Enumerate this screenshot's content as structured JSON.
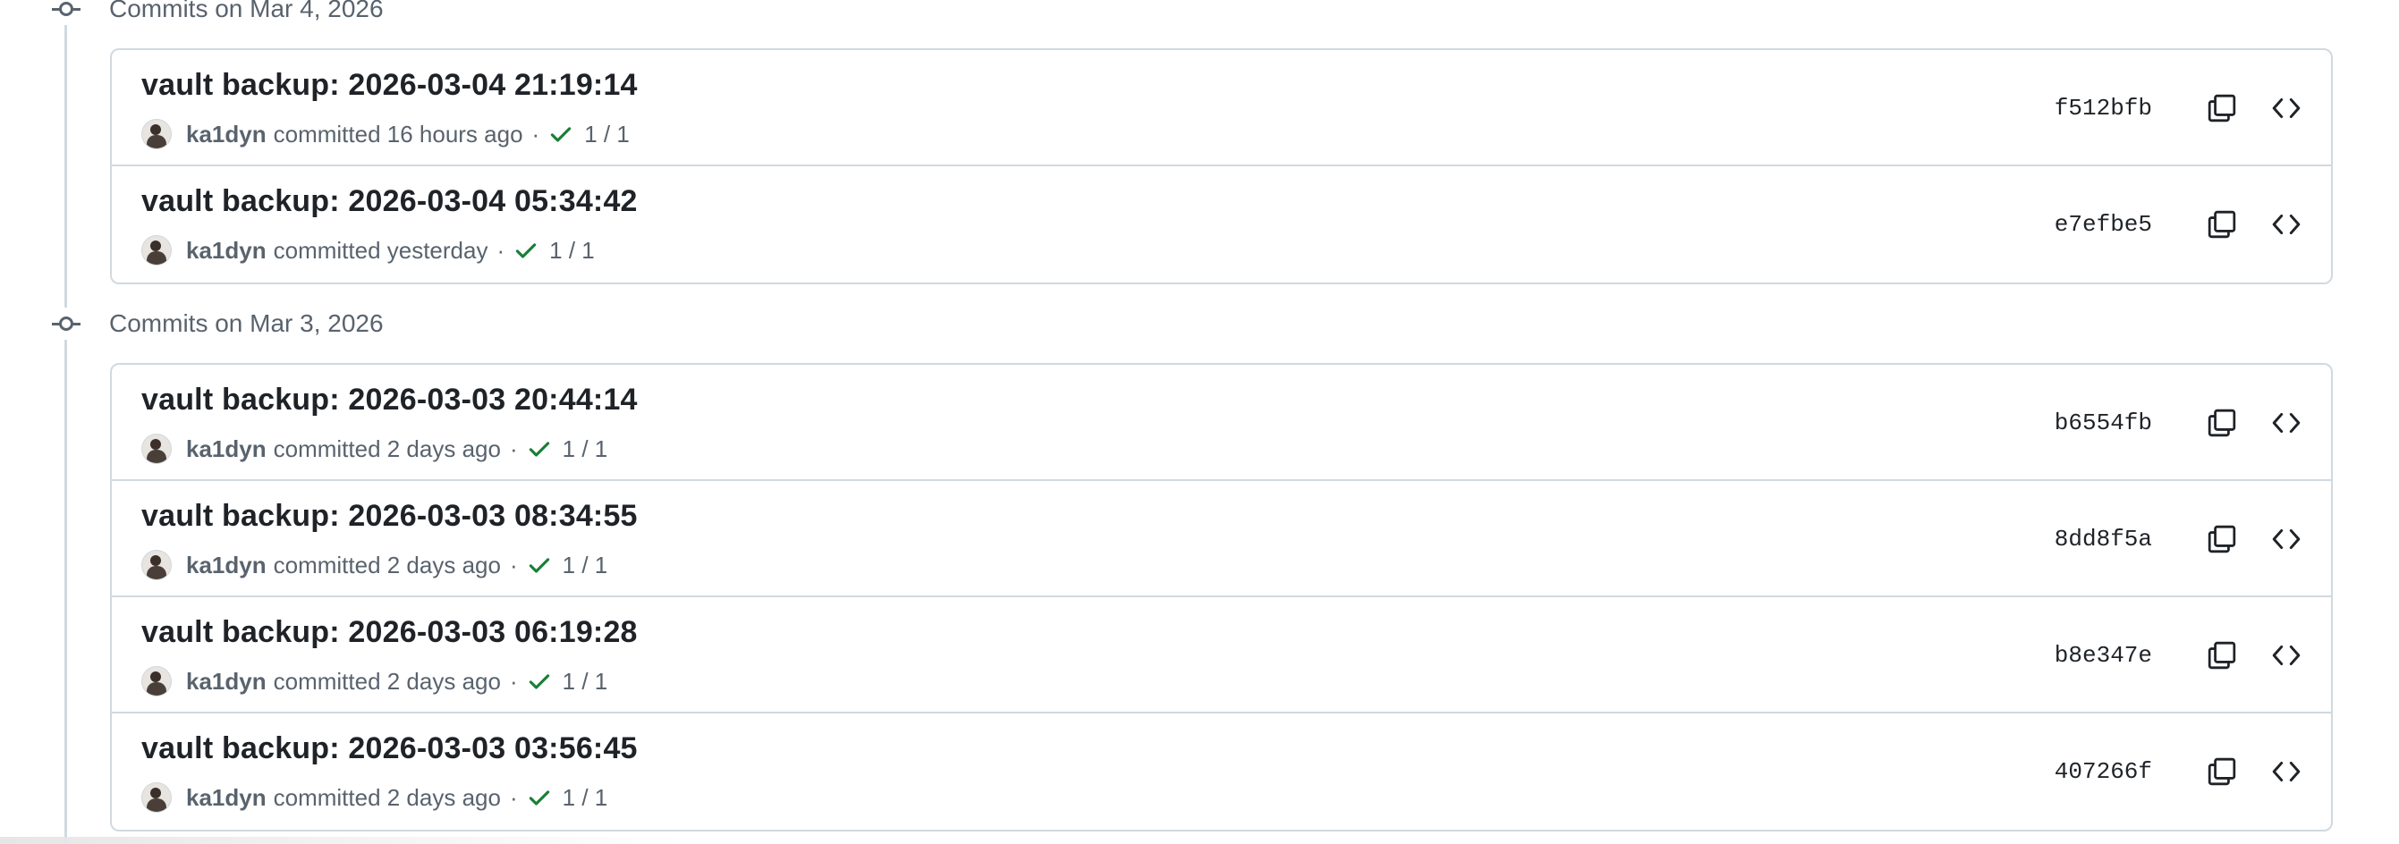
{
  "groups": [
    {
      "title": "Commits on Mar 4, 2026",
      "commits": [
        {
          "title": "vault backup: 2026-03-04 21:19:14",
          "author": "ka1dyn",
          "time": "committed 16 hours ago",
          "checks": "1 / 1",
          "sha": "f512bfb"
        },
        {
          "title": "vault backup: 2026-03-04 05:34:42",
          "author": "ka1dyn",
          "time": "committed yesterday",
          "checks": "1 / 1",
          "sha": "e7efbe5"
        }
      ]
    },
    {
      "title": "Commits on Mar 3, 2026",
      "commits": [
        {
          "title": "vault backup: 2026-03-03 20:44:14",
          "author": "ka1dyn",
          "time": "committed 2 days ago",
          "checks": "1 / 1",
          "sha": "b6554fb"
        },
        {
          "title": "vault backup: 2026-03-03 08:34:55",
          "author": "ka1dyn",
          "time": "committed 2 days ago",
          "checks": "1 / 1",
          "sha": "8dd8f5a"
        },
        {
          "title": "vault backup: 2026-03-03 06:19:28",
          "author": "ka1dyn",
          "time": "committed 2 days ago",
          "checks": "1 / 1",
          "sha": "b8e347e"
        },
        {
          "title": "vault backup: 2026-03-03 03:56:45",
          "author": "ka1dyn",
          "time": "committed 2 days ago",
          "checks": "1 / 1",
          "sha": "407266f"
        }
      ]
    }
  ],
  "separator": "·",
  "icons": {
    "group": "git-commit-icon",
    "check": "check-icon",
    "copy": "copy-icon",
    "browse": "code-icon"
  },
  "colors": {
    "check": "#1a7f37",
    "border": "#d1d9e0",
    "muted": "#59636e"
  }
}
